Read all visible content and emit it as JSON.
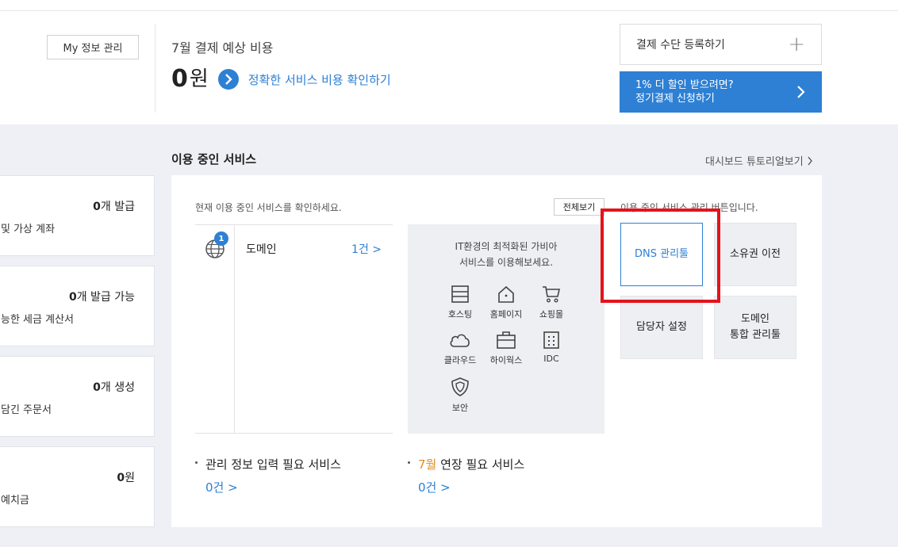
{
  "header": {
    "my_info_button": "My 정보 관리",
    "payment_title": "7월 결제 예상 비용",
    "amount": "0",
    "amount_unit": "원",
    "amount_link": "정확한 서비스 비용 확인하기",
    "register_payment": "결제 수단 등록하기",
    "promo_line1": "1% 더 할인 받으려면?",
    "promo_line2": "정기결제 신청하기"
  },
  "left_cards": [
    {
      "value_num": "0",
      "value_suffix": "개 발급",
      "label": "및 가상 계좌"
    },
    {
      "value_num": "0",
      "value_suffix": "개 발급 가능",
      "label": "능한 세금 계산서"
    },
    {
      "value_num": "0",
      "value_suffix": "개 생성",
      "label": "담긴 주문서"
    },
    {
      "value_num": "0",
      "value_suffix": "원",
      "label": "예치금"
    }
  ],
  "services": {
    "title": "이용 중인 서비스",
    "tutorial_link": "대시보드 튜토리얼보기",
    "caption": "현재 이용 중인 서비스를 확인하세요.",
    "view_all": "전체보기",
    "caption2": "이용 중인 서비스 관리 버튼입니다.",
    "domain": {
      "name": "도메인",
      "count": "1건 >",
      "badge": "1"
    },
    "promo_line1": "IT환경의 최적화된 가비아",
    "promo_line2": "서비스를 이용해보세요.",
    "items": [
      {
        "label": "호스팅",
        "icon": "hosting-icon"
      },
      {
        "label": "홈페이지",
        "icon": "homepage-icon"
      },
      {
        "label": "쇼핑몰",
        "icon": "cart-icon"
      },
      {
        "label": "클라우드",
        "icon": "cloud-icon"
      },
      {
        "label": "하이웍스",
        "icon": "briefcase-icon"
      },
      {
        "label": "IDC",
        "icon": "building-icon"
      },
      {
        "label": "보안",
        "icon": "shield-icon"
      }
    ],
    "mgmt": {
      "dns": "DNS 관리툴",
      "transfer": "소유권 이전",
      "contact": "담당자 설정",
      "integrated_line1": "도메인",
      "integrated_line2": "통합 관리툴"
    },
    "bottom": {
      "mgmt_info_label": "관리 정보 입력 필요 서비스",
      "mgmt_info_count": "0건 >",
      "renew_month": "7월",
      "renew_label": " 연장 필요 서비스",
      "renew_count": "0건 >"
    }
  },
  "colors": {
    "accent": "#2d80d4",
    "highlight": "#e3141c",
    "month": "#e58a1f"
  }
}
